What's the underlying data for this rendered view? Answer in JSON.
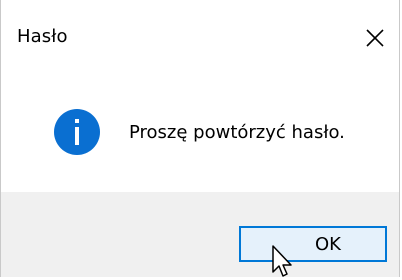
{
  "dialog": {
    "title": "Hasło",
    "message": "Proszę powtórzyć hasło.",
    "ok_label": "OK"
  },
  "icons": {
    "close": "close-icon",
    "info": "info-icon",
    "cursor": "mouse-pointer-icon"
  },
  "colors": {
    "info_icon": "#0a6fd1",
    "button_border": "#0078d7",
    "button_fill": "#e5f1fb",
    "footer_bg": "#f0f0f0"
  }
}
